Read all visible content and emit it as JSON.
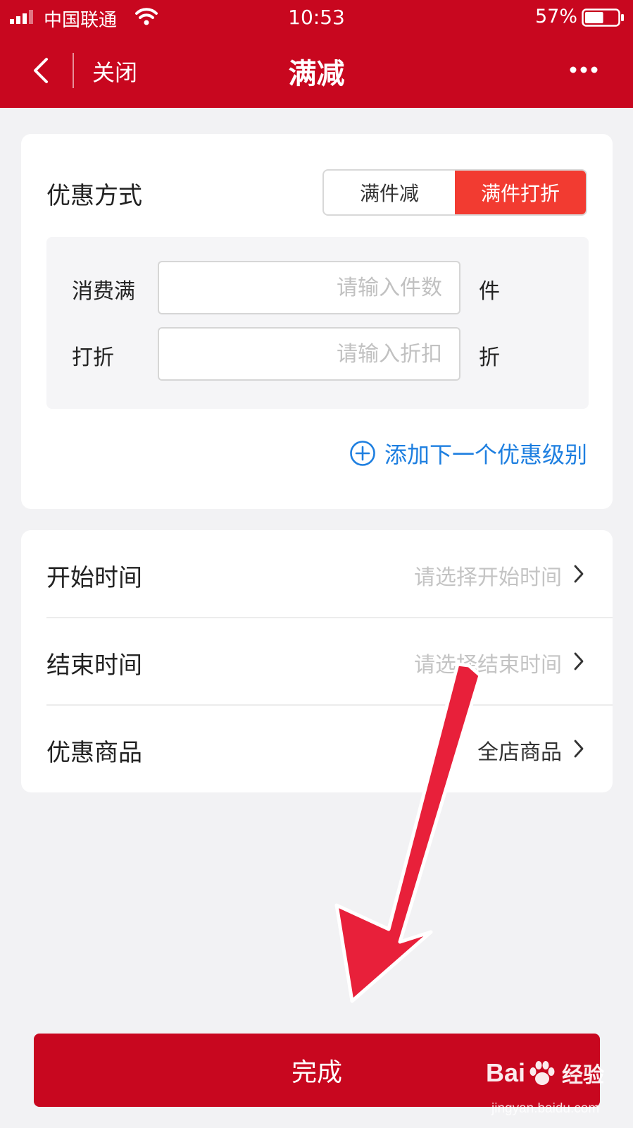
{
  "status_bar": {
    "carrier": "中国联通",
    "time": "10:53",
    "battery": "57%",
    "battery_level": 0.57
  },
  "nav": {
    "close_label": "关闭",
    "title": "满减"
  },
  "discount": {
    "label": "优惠方式",
    "options": [
      "满件减",
      "满件打折"
    ],
    "selected_index": 1,
    "fields": [
      {
        "label": "消费满",
        "placeholder": "请输入件数",
        "value": "",
        "unit": "件"
      },
      {
        "label": "打折",
        "placeholder": "请输入折扣",
        "value": "",
        "unit": "折"
      }
    ],
    "add_level_label": "添加下一个优惠级别"
  },
  "settings": [
    {
      "label": "开始时间",
      "value": "请选择开始时间",
      "is_placeholder": true
    },
    {
      "label": "结束时间",
      "value": "请选择结束时间",
      "is_placeholder": true
    },
    {
      "label": "优惠商品",
      "value": "全店商品",
      "is_placeholder": false
    }
  ],
  "done_label": "完成",
  "watermark": {
    "logo_left": "Bai",
    "logo_right": "经验",
    "url": "jingyan.baidu.com"
  },
  "colors": {
    "brand_red": "#c8071f",
    "active_segment": "#f23b31",
    "link_blue": "#1e7fe0",
    "annotation_arrow": "#e8203a"
  }
}
